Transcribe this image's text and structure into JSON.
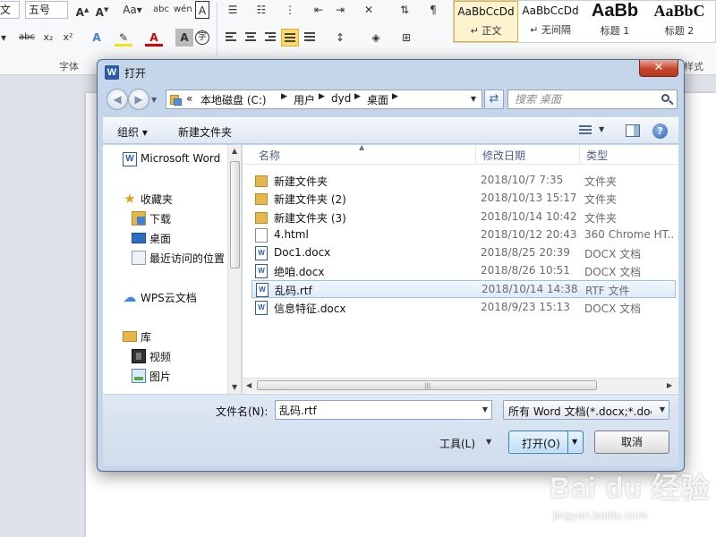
{
  "ribbon": {
    "font_name": "文",
    "font_size": "五号",
    "font_group_label": "字体",
    "styles_group_label": "样式",
    "styles": [
      {
        "sample": "AaBbCcDd",
        "name": "↵ 正文"
      },
      {
        "sample": "AaBbCcDd",
        "name": "↵ 无间隔"
      },
      {
        "sample": "AaBb",
        "name": "标题 1"
      },
      {
        "sample": "AaBbC",
        "name": "标题 2"
      }
    ]
  },
  "dialog": {
    "title": "打开",
    "close_glyph": "✕",
    "address": {
      "overflow": "«",
      "crumbs": [
        "本地磁盘 (C:)",
        "用户",
        "dyd",
        "桌面"
      ]
    },
    "search_placeholder": "搜索 桌面",
    "toolbar": {
      "organize": "组织 ▾",
      "new_folder": "新建文件夹"
    },
    "nav_items": [
      {
        "label": "Microsoft Word",
        "icon": "word-icon"
      },
      {
        "label": "收藏夹",
        "icon": "star-icon"
      },
      {
        "label": "下载",
        "icon": "downloads-folder-icon"
      },
      {
        "label": "桌面",
        "icon": "desktop-icon"
      },
      {
        "label": "最近访问的位置",
        "icon": "recent-places-icon"
      },
      {
        "label": "WPS云文档",
        "icon": "cloud-icon"
      },
      {
        "label": "库",
        "icon": "library-icon"
      },
      {
        "label": "视频",
        "icon": "video-icon"
      },
      {
        "label": "图片",
        "icon": "image-icon"
      }
    ],
    "columns": [
      "名称",
      "修改日期",
      "类型"
    ],
    "files": [
      {
        "name": "新建文件夹",
        "date": "2018/10/7 7:35",
        "type": "文件夹",
        "icon": "folder-icon",
        "selected": false
      },
      {
        "name": "新建文件夹 (2)",
        "date": "2018/10/13 15:17",
        "type": "文件夹",
        "icon": "folder-icon",
        "selected": false
      },
      {
        "name": "新建文件夹 (3)",
        "date": "2018/10/14 10:42",
        "type": "文件夹",
        "icon": "folder-icon",
        "selected": false
      },
      {
        "name": "4.html",
        "date": "2018/10/12 20:43",
        "type": "360 Chrome HT...",
        "icon": "html-file-icon",
        "selected": false
      },
      {
        "name": "Doc1.docx",
        "date": "2018/8/25 20:39",
        "type": "DOCX 文档",
        "icon": "docx-file-icon",
        "selected": false
      },
      {
        "name": "绝咱.docx",
        "date": "2018/8/26 10:51",
        "type": "DOCX 文档",
        "icon": "docx-file-icon",
        "selected": false
      },
      {
        "name": "乱码.rtf",
        "date": "2018/10/14 14:38",
        "type": "RTF 文件",
        "icon": "rtf-file-icon",
        "selected": true
      },
      {
        "name": "信息特征.docx",
        "date": "2018/9/23 15:13",
        "type": "DOCX 文档",
        "icon": "docx-file-icon",
        "selected": false
      }
    ],
    "filename_label": "文件名(N):",
    "filename_value": "乱码.rtf",
    "filetype_value": "所有 Word 文档(*.docx;*.docm",
    "tools_label": "工具(L)",
    "open_label": "打开(O)",
    "cancel_label": "取消"
  },
  "watermark": {
    "logo": "Bai du 经验",
    "url": "jingyan.baidu.com"
  }
}
